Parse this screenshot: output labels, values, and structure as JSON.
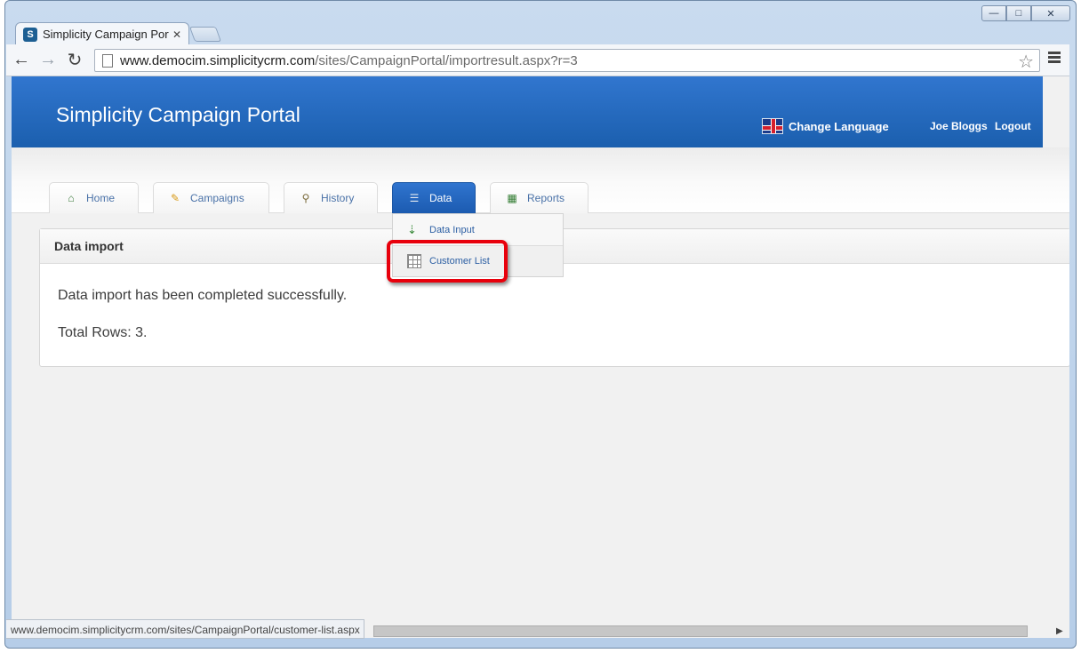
{
  "browser": {
    "tab_title": "Simplicity Campaign Port",
    "tab_favicon_letter": "S",
    "url_host": "www.democim.simplicitycrm.com",
    "url_path": "/sites/CampaignPortal/importresult.aspx?r=3",
    "status_url": "www.democim.simplicitycrm.com/sites/CampaignPortal/customer-list.aspx"
  },
  "header": {
    "title": "Simplicity Campaign Portal",
    "change_language": "Change Language",
    "user_name": "Joe Bloggs",
    "logout": "Logout"
  },
  "nav": {
    "tabs": [
      {
        "label": "Home",
        "icon": "home-icon"
      },
      {
        "label": "Campaigns",
        "icon": "pencil-icon"
      },
      {
        "label": "History",
        "icon": "magnifier-icon"
      },
      {
        "label": "Data",
        "icon": "database-icon",
        "active": true
      },
      {
        "label": "Reports",
        "icon": "chart-icon"
      }
    ],
    "data_menu": [
      {
        "label": "Data Input",
        "icon": "download-icon"
      },
      {
        "label": "Customer List",
        "icon": "grid-icon",
        "highlighted": true
      }
    ]
  },
  "panel": {
    "title": "Data import",
    "message": "Data import has been completed successfully.",
    "total_rows": "Total Rows: 3."
  },
  "colors": {
    "banner": "#2268bd",
    "highlight": "#e8000c",
    "link": "#4a72a8"
  }
}
